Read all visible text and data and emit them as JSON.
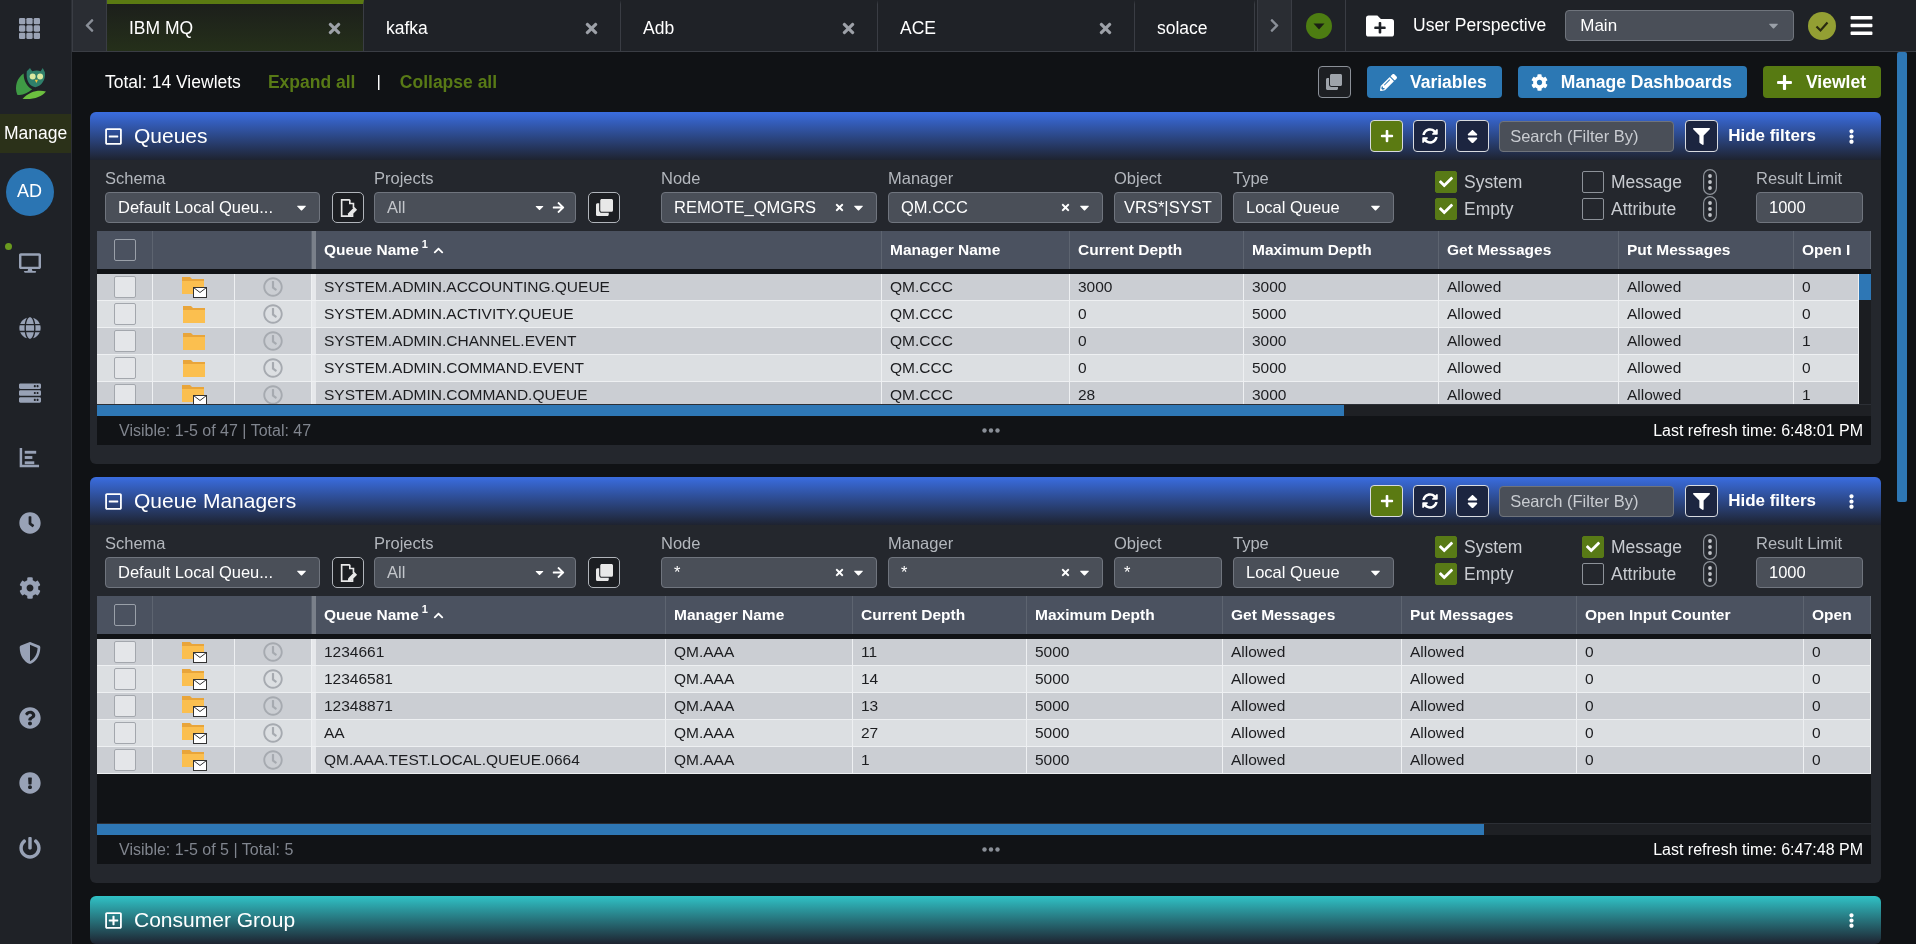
{
  "sidebar": {
    "label": "Manage",
    "avatar": "AD",
    "nav": [
      {
        "kind": "monitor",
        "badge": true
      },
      {
        "kind": "globe",
        "badge": false
      },
      {
        "kind": "server",
        "badge": false
      },
      {
        "kind": "reports",
        "badge": false
      },
      {
        "kind": "history",
        "badge": false
      },
      {
        "kind": "settings",
        "badge": false
      },
      {
        "kind": "security",
        "badge": false
      },
      {
        "kind": "help",
        "badge": false
      },
      {
        "kind": "alerts",
        "badge": false
      },
      {
        "kind": "logout",
        "badge": false
      }
    ]
  },
  "tabs": [
    {
      "label": "IBM MQ",
      "selected": true,
      "closable": true
    },
    {
      "label": "kafka",
      "selected": false,
      "closable": true
    },
    {
      "label": "Adb",
      "selected": false,
      "closable": true
    },
    {
      "label": "ACE",
      "selected": false,
      "closable": true
    },
    {
      "label": "solace",
      "selected": false,
      "closable": false
    }
  ],
  "perspective": {
    "label": "User Perspective",
    "value": "Main"
  },
  "toolbar": {
    "total": "Total: 14 Viewlets",
    "expand_all": "Expand all",
    "separator": "|",
    "collapse_all": "Collapse all",
    "buttons": [
      {
        "kind": "edit",
        "label": "Variables"
      },
      {
        "kind": "settings",
        "label": "Manage Dashboards"
      },
      {
        "kind": "add",
        "label": "Viewlet"
      }
    ]
  },
  "viewlets": [
    {
      "title": "Queues",
      "expanded": true,
      "color": "#3a6de0",
      "search_placeholder": "Search (Filter By)",
      "filter_toggle": "Hide filters",
      "filters": {
        "schema": {
          "label": "Schema",
          "value": "Default Local Queu..."
        },
        "projects": {
          "label": "Projects",
          "value": "All"
        },
        "node": {
          "label": "Node",
          "value": "REMOTE_QMGRS"
        },
        "manager": {
          "label": "Manager",
          "value": "QM.CCC"
        },
        "object": {
          "label": "Object",
          "value": "VRS*|SYST"
        },
        "type": {
          "label": "Type",
          "value": "Local Queue"
        },
        "options": [
          {
            "label": "System",
            "checked": true,
            "menu": false
          },
          {
            "label": "Empty",
            "checked": true,
            "menu": false
          },
          {
            "label": "Message",
            "checked": false,
            "menu": true
          },
          {
            "label": "Attribute",
            "checked": false,
            "menu": true
          }
        ],
        "result_limit": {
          "label": "Result Limit",
          "value": "1000"
        }
      },
      "table": {
        "select_all": false,
        "columns": [
          {
            "label": "Queue Name",
            "sort_order": "1",
            "sort_ascending": true
          },
          {
            "label": "Manager Name"
          },
          {
            "label": "Current Depth"
          },
          {
            "label": "Maximum Depth"
          },
          {
            "label": "Get Messages"
          },
          {
            "label": "Put Messages"
          },
          {
            "label": "Open I"
          }
        ],
        "rows": [
          {
            "selected": false,
            "kind": "folder-envelope",
            "cells": [
              "SYSTEM.ADMIN.ACCOUNTING.QUEUE",
              "QM.CCC",
              "3000",
              "3000",
              "Allowed",
              "Allowed",
              "0"
            ]
          },
          {
            "selected": false,
            "kind": "folder",
            "cells": [
              "SYSTEM.ADMIN.ACTIVITY.QUEUE",
              "QM.CCC",
              "0",
              "5000",
              "Allowed",
              "Allowed",
              "0"
            ]
          },
          {
            "selected": false,
            "kind": "folder",
            "cells": [
              "SYSTEM.ADMIN.CHANNEL.EVENT",
              "QM.CCC",
              "0",
              "3000",
              "Allowed",
              "Allowed",
              "1"
            ]
          },
          {
            "selected": false,
            "kind": "folder",
            "cells": [
              "SYSTEM.ADMIN.COMMAND.EVENT",
              "QM.CCC",
              "0",
              "5000",
              "Allowed",
              "Allowed",
              "0"
            ]
          },
          {
            "selected": false,
            "kind": "folder-envelope",
            "cells": [
              "SYSTEM.ADMIN.COMMAND.QUEUE",
              "QM.CCC",
              "28",
              "3000",
              "Allowed",
              "Allowed",
              "1"
            ]
          }
        ]
      },
      "footer": {
        "visible": "Visible: 1-5 of 47 | Total: 47",
        "refresh": "Last refresh time: 6:48:01 PM"
      }
    },
    {
      "title": "Queue Managers",
      "expanded": true,
      "color": "#3a6de0",
      "search_placeholder": "Search (Filter By)",
      "filter_toggle": "Hide filters",
      "filters": {
        "schema": {
          "label": "Schema",
          "value": "Default Local Queu..."
        },
        "projects": {
          "label": "Projects",
          "value": "All"
        },
        "node": {
          "label": "Node",
          "value": "*"
        },
        "manager": {
          "label": "Manager",
          "value": "*"
        },
        "object": {
          "label": "Object",
          "value": "*"
        },
        "type": {
          "label": "Type",
          "value": "Local Queue"
        },
        "options": [
          {
            "label": "System",
            "checked": true,
            "menu": false
          },
          {
            "label": "Empty",
            "checked": true,
            "menu": false
          },
          {
            "label": "Message",
            "checked": true,
            "menu": true
          },
          {
            "label": "Attribute",
            "checked": false,
            "menu": true
          }
        ],
        "result_limit": {
          "label": "Result Limit",
          "value": "1000"
        }
      },
      "table": {
        "select_all": false,
        "columns": [
          {
            "label": "Queue Name",
            "sort_order": "1",
            "sort_ascending": true
          },
          {
            "label": "Manager Name"
          },
          {
            "label": "Current Depth"
          },
          {
            "label": "Maximum Depth"
          },
          {
            "label": "Get Messages"
          },
          {
            "label": "Put Messages"
          },
          {
            "label": "Open Input Counter"
          },
          {
            "label": "Open"
          }
        ],
        "rows": [
          {
            "selected": false,
            "kind": "folder-envelope",
            "cells": [
              "1234661",
              "QM.AAA",
              "11",
              "5000",
              "Allowed",
              "Allowed",
              "0",
              "0"
            ]
          },
          {
            "selected": false,
            "kind": "folder-envelope",
            "cells": [
              "12346581",
              "QM.AAA",
              "14",
              "5000",
              "Allowed",
              "Allowed",
              "0",
              "0"
            ]
          },
          {
            "selected": false,
            "kind": "folder-envelope",
            "cells": [
              "12348871",
              "QM.AAA",
              "13",
              "5000",
              "Allowed",
              "Allowed",
              "0",
              "0"
            ]
          },
          {
            "selected": false,
            "kind": "folder-envelope",
            "cells": [
              "AA",
              "QM.AAA",
              "27",
              "5000",
              "Allowed",
              "Allowed",
              "0",
              "0"
            ]
          },
          {
            "selected": false,
            "kind": "folder-envelope",
            "cells": [
              "QM.AAA.TEST.LOCAL.QUEUE.0664",
              "QM.AAA",
              "1",
              "5000",
              "Allowed",
              "Allowed",
              "0",
              "0"
            ]
          }
        ]
      },
      "footer": {
        "visible": "Visible: 1-5 of 5 | Total: 5",
        "refresh": "Last refresh time: 6:47:48 PM"
      }
    },
    {
      "title": "Consumer Group",
      "expanded": false,
      "color": "#30c2c6"
    }
  ]
}
